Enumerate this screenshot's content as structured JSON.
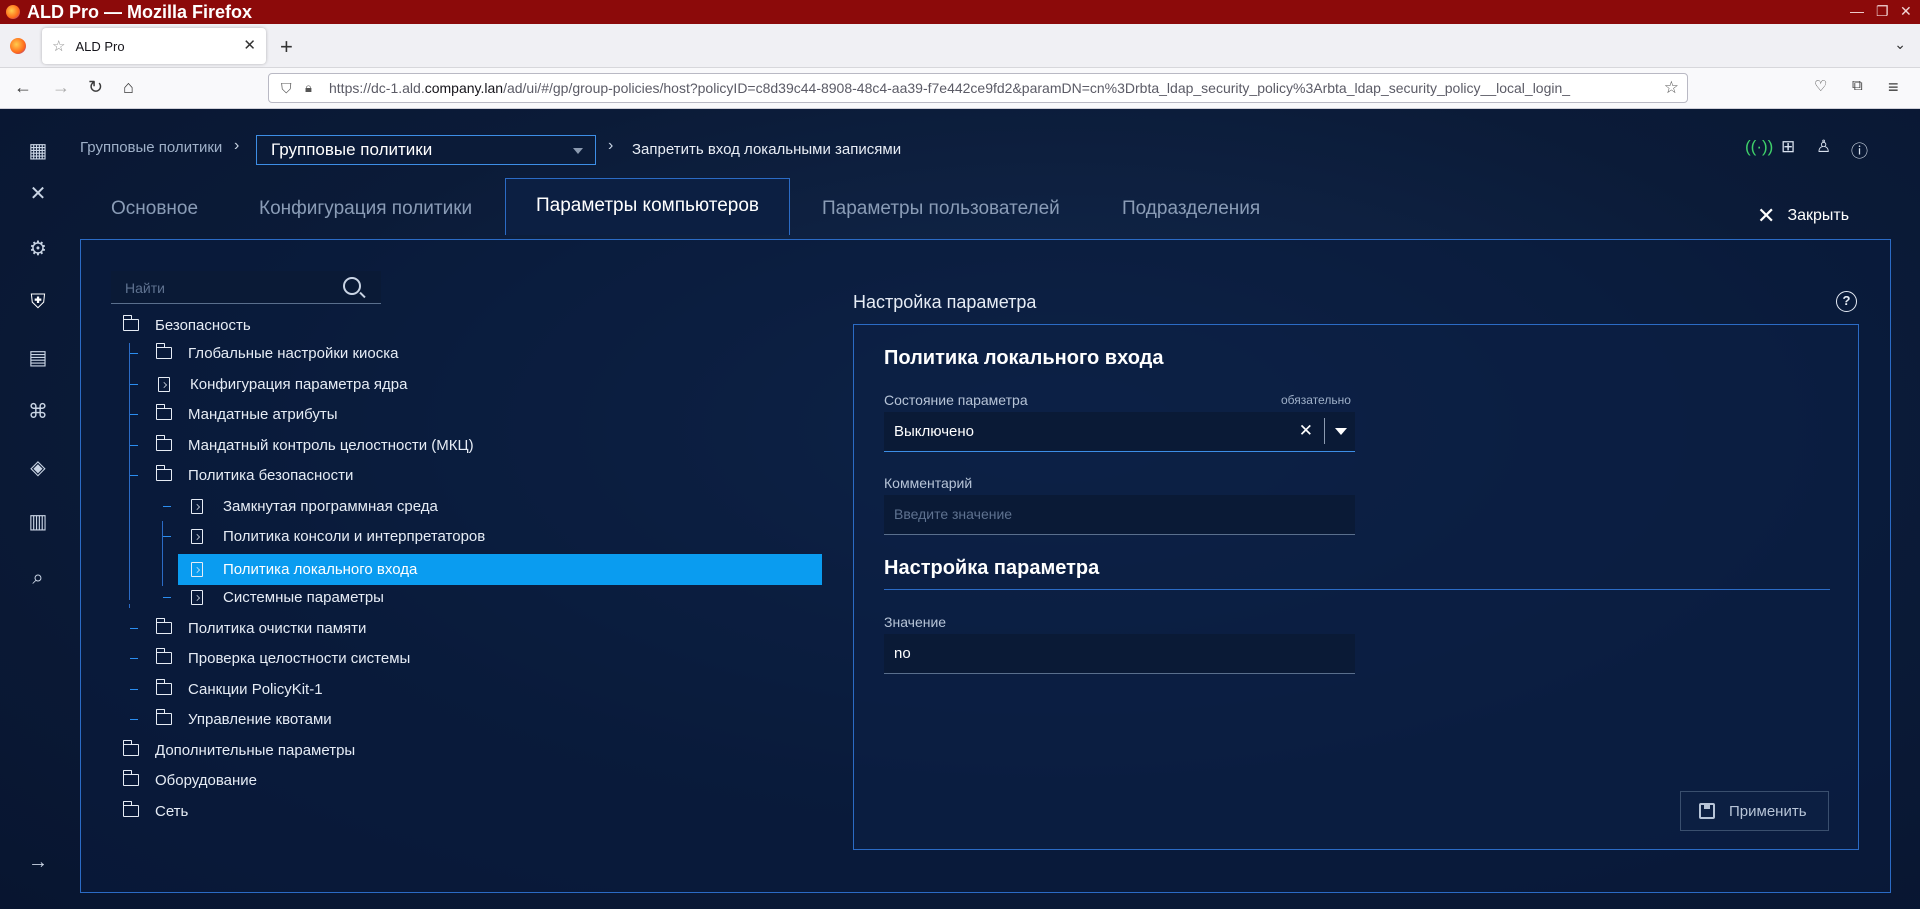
{
  "window": {
    "title": "ALD Pro — Mozilla Firefox"
  },
  "browser": {
    "tab_title": "ALD Pro",
    "url_prefix": "https://dc-1.ald.",
    "url_domain": "company.lan",
    "url_rest": "/ad/ui/#/gp/group-policies/host?policyID=c8d39c44-8908-48c4-aa39-f7e442ce9fd2&paramDN=cn%3Drbta_ldap_security_policy%3Arbta_ldap_security_policy__local_login_"
  },
  "header": {
    "breadcrumb_root": "Групповые политики",
    "group_select": "Групповые политики",
    "current": "Запретить вход локальными записями"
  },
  "tabs": [
    {
      "label": "Основное"
    },
    {
      "label": "Конфигурация политики"
    },
    {
      "label": "Параметры компьютеров"
    },
    {
      "label": "Параметры пользователей"
    },
    {
      "label": "Подразделения"
    }
  ],
  "close_label": "Закрыть",
  "search": {
    "placeholder": "Найти"
  },
  "tree": [
    {
      "label": "Безопасность"
    },
    {
      "label": "Глобальные настройки киоска"
    },
    {
      "label": "Конфигурация параметра ядра"
    },
    {
      "label": "Мандатные атрибуты"
    },
    {
      "label": "Мандатный контроль целостности (МКЦ)"
    },
    {
      "label": "Политика безопасности"
    },
    {
      "label": "Замкнутая программная среда"
    },
    {
      "label": "Политика консоли и интерпретаторов"
    },
    {
      "label": "Политика локального входа"
    },
    {
      "label": "Системные параметры"
    },
    {
      "label": "Политика очистки памяти"
    },
    {
      "label": "Проверка целостности системы"
    },
    {
      "label": "Санкции PolicyKit-1"
    },
    {
      "label": "Управление квотами"
    },
    {
      "label": "Дополнительные параметры"
    },
    {
      "label": "Оборудование"
    },
    {
      "label": "Сеть"
    }
  ],
  "settings": {
    "section_title": "Настройка параметра",
    "policy_title": "Политика локального входа",
    "state_label": "Состояние параметра",
    "required_label": "обязательно",
    "state_value": "Выключено",
    "comment_label": "Комментарий",
    "comment_placeholder": "Введите значение",
    "param_title": "Настройка параметра",
    "value_label": "Значение",
    "value": "no",
    "apply_label": "Применить"
  }
}
